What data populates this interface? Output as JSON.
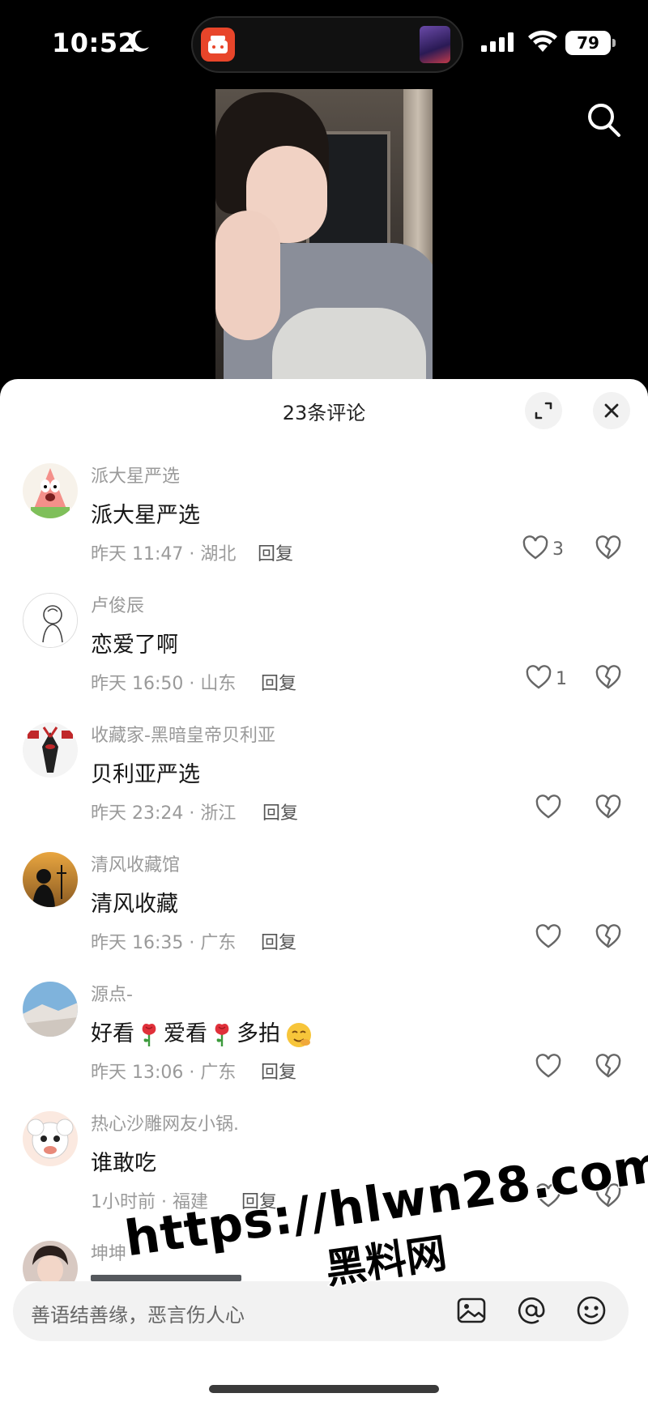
{
  "status_bar": {
    "time": "10:52",
    "battery": "79"
  },
  "sheet": {
    "title": "23条评论"
  },
  "comments": [
    {
      "user": "派大星严选",
      "text": "派大星严选",
      "meta": "昨天 11:47 · 湖北",
      "reply": "回复",
      "likes": "3"
    },
    {
      "user": "卢俊辰",
      "text": "恋爱了啊",
      "meta": "昨天 16:50 · 山东",
      "reply": "回复",
      "likes": "1"
    },
    {
      "user": "收藏家-黑暗皇帝贝利亚",
      "text": "贝利亚严选",
      "meta": "昨天 23:24 · 浙江",
      "reply": "回复",
      "likes": ""
    },
    {
      "user": "清风收藏馆",
      "text": "清风收藏",
      "meta": "昨天 16:35 · 广东",
      "reply": "回复",
      "likes": ""
    },
    {
      "user": "源点-",
      "text_parts": [
        "好看",
        "爱看",
        "多拍"
      ],
      "meta": "昨天 13:06 · 广东",
      "reply": "回复",
      "likes": ""
    },
    {
      "user": "热心沙雕网友小锅.",
      "text": "谁敢吃",
      "meta": "1小时前 · 福建",
      "reply": "回复",
      "likes": ""
    },
    {
      "user": "坤坤"
    }
  ],
  "input": {
    "placeholder": "善语结善缘，恶言伤人心"
  },
  "watermark": {
    "url": "https://hlwn28.com",
    "name": "黑料网"
  },
  "colors": {
    "background": "#000000",
    "sheet": "#ffffff",
    "muted_text": "#9a9a9a"
  }
}
